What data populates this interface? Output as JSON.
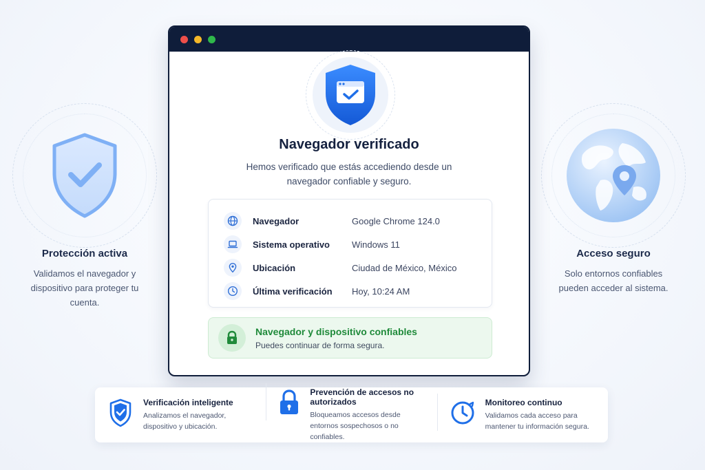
{
  "left_panel": {
    "title": "Protección activa",
    "description": "Validamos el navegador y dispositivo para proteger tu cuenta.",
    "icon": "shield-check-icon"
  },
  "right_panel": {
    "title": "Acceso seguro",
    "description": "Solo entornos confiables pueden acceder al sistema.",
    "icon": "globe-location-icon"
  },
  "window": {
    "title": "Navegador verificado",
    "subtitle": "Hemos verificado que estás accediendo desde un navegador confiable y seguro.",
    "hero_icon": "shield-browser-check-icon",
    "info": [
      {
        "icon": "globe-icon",
        "label": "Navegador",
        "value": "Google Chrome 124.0"
      },
      {
        "icon": "laptop-icon",
        "label": "Sistema operativo",
        "value": "Windows 11"
      },
      {
        "icon": "location-pin-icon",
        "label": "Ubicación",
        "value": "Ciudad de México, México"
      },
      {
        "icon": "clock-icon",
        "label": "Última verificación",
        "value": "Hoy, 10:24 AM"
      }
    ],
    "status": {
      "title": "Navegador y dispositivo confiables",
      "subtitle": "Puedes continuar de forma segura.",
      "icon": "lock-icon"
    }
  },
  "features": [
    {
      "icon": "shield-check-icon",
      "title": "Verificación inteligente",
      "description": "Analizamos el navegador, dispositivo y ubicación."
    },
    {
      "icon": "lock-icon",
      "title": "Prevención de accesos no autorizados",
      "description": "Bloqueamos accesos desde entornos sospechosos o no confiables."
    },
    {
      "icon": "clock-icon",
      "title": "Monitoreo continuo",
      "description": "Validamos cada acceso para mantener tu información segura."
    }
  ],
  "colors": {
    "accent": "#1f6fe8",
    "success": "#1f8a3a",
    "titlebar": "#0f1d3a"
  }
}
